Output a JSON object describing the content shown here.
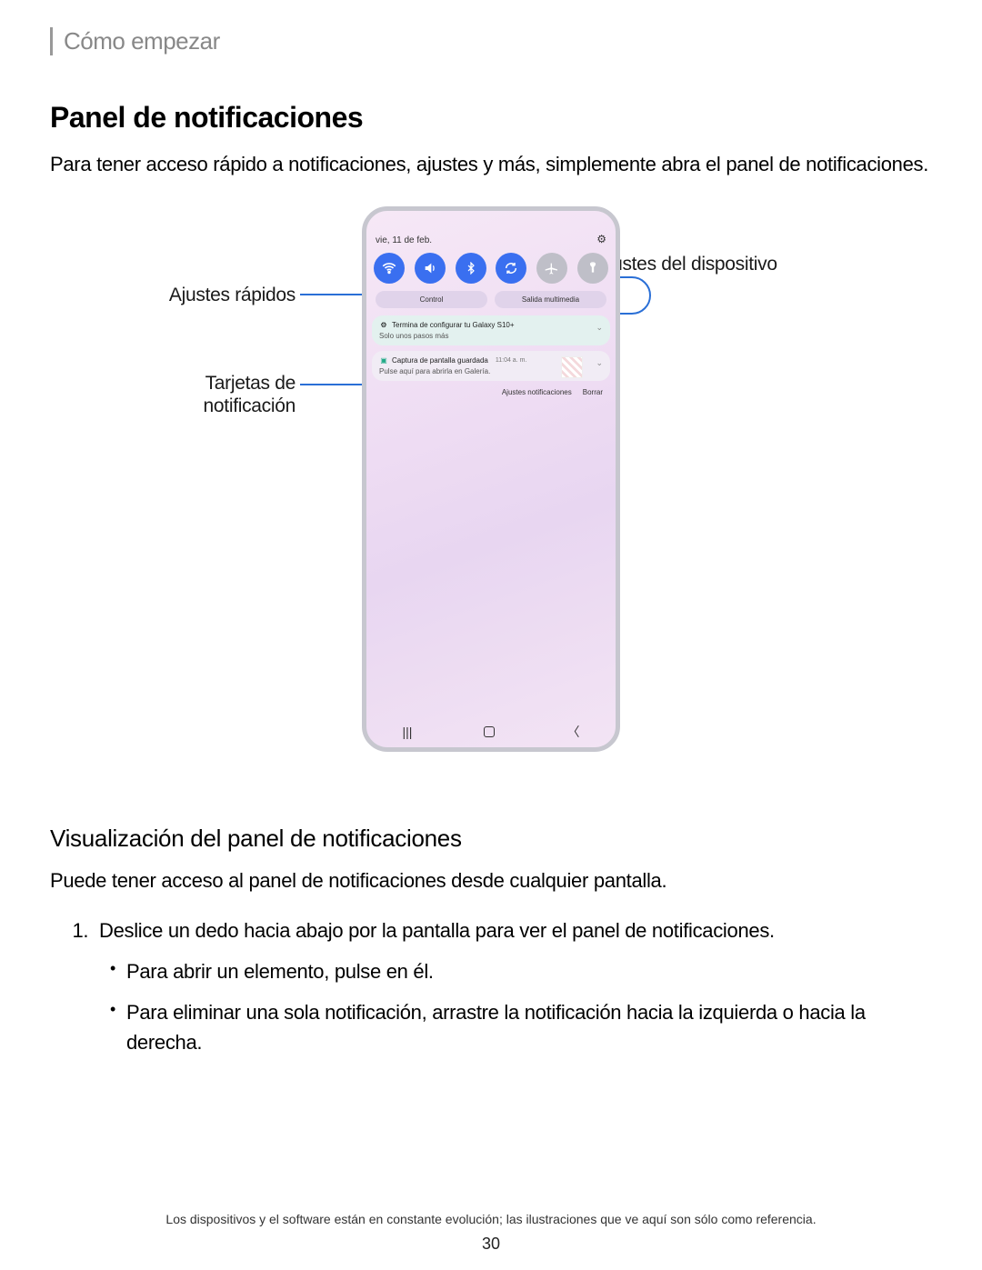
{
  "breadcrumb": "Cómo empezar",
  "h1": "Panel de notificaciones",
  "intro": "Para tener acceso rápido a notificaciones, ajustes y más, simplemente abra el panel de notificaciones.",
  "callouts": {
    "quick_settings": "Ajustes rápidos",
    "notification_cards_l1": "Tarjetas de",
    "notification_cards_l2": "notificación",
    "device_settings": "Ajustes del dispositivo"
  },
  "phone": {
    "date": "vie, 11 de feb.",
    "pills": {
      "control": "Control",
      "media": "Salida multimedia"
    },
    "card1": {
      "title": "Termina de configurar tu Galaxy S10+",
      "sub": "Solo unos pasos más"
    },
    "card2": {
      "title": "Captura de pantalla guardada",
      "time": "11:04 a. m.",
      "sub": "Pulse aquí para abrirla en Galería."
    },
    "actions": {
      "settings": "Ajustes notificaciones",
      "clear": "Borrar"
    }
  },
  "h2": "Visualización del panel de notificaciones",
  "p2": "Puede tener acceso al panel de notificaciones desde cualquier pantalla.",
  "steps": {
    "s1": "Deslice un dedo hacia abajo por la pantalla para ver el panel de notificaciones.",
    "b1": "Para abrir un elemento, pulse en él.",
    "b2": "Para eliminar una sola notificación, arrastre la notificación hacia la izquierda o hacia la derecha."
  },
  "footnote": "Los dispositivos y el software están en constante evolución; las ilustraciones que ve aquí son sólo como referencia.",
  "pagenum": "30"
}
